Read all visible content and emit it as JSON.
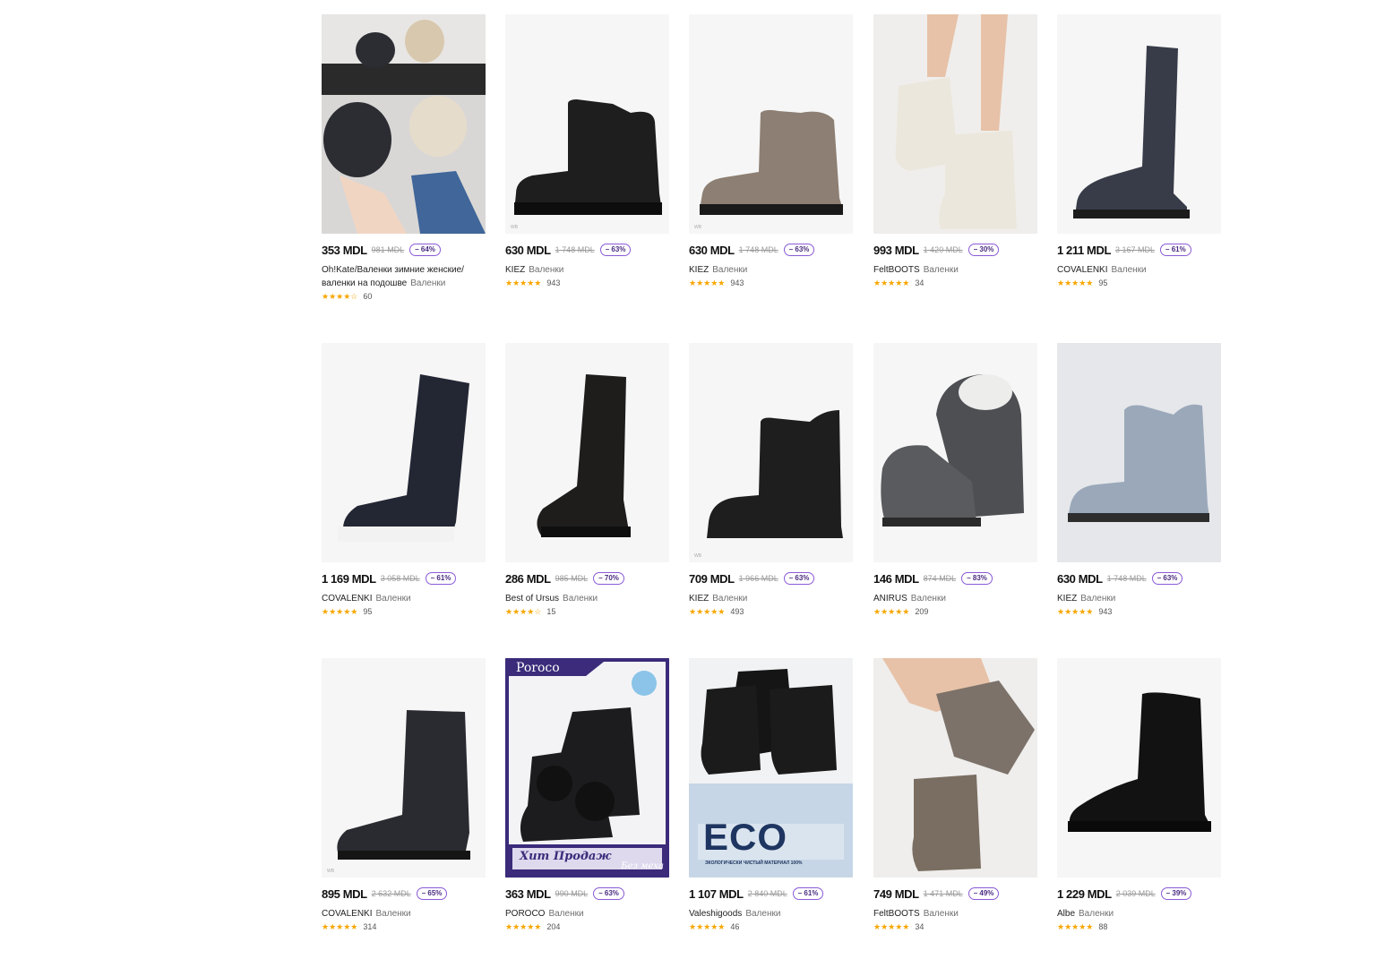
{
  "products": [
    {
      "price": "353 MDL",
      "old": "981 MDL",
      "discount": "– 64%",
      "brand": "Oh!Kate/Валенки зимние женские/валенки на подошве",
      "category": "Валенки",
      "stars": "★★★★☆",
      "reviews": "60",
      "image": "women-dark-boots-photo"
    },
    {
      "price": "630 MDL",
      "old": "1 748 MDL",
      "discount": "– 63%",
      "brand": "KIEZ",
      "category": "Валенки",
      "stars": "★★★★★",
      "reviews": "943",
      "image": "black-short-felt-boot",
      "wb": "WB"
    },
    {
      "price": "630 MDL",
      "old": "1 748 MDL",
      "discount": "– 63%",
      "brand": "KIEZ",
      "category": "Валенки",
      "stars": "★★★★★",
      "reviews": "943",
      "image": "beige-short-felt-boot",
      "wb": "WB"
    },
    {
      "price": "993 MDL",
      "old": "1 420 MDL",
      "discount": "– 30%",
      "brand": "FeltBOOTS",
      "category": "Валенки",
      "stars": "★★★★★",
      "reviews": "34",
      "image": "white-felt-boots-on-legs"
    },
    {
      "price": "1 211 MDL",
      "old": "3 167 MDL",
      "discount": "– 61%",
      "brand": "COVALENKI",
      "category": "Валенки",
      "stars": "★★★★★",
      "reviews": "95",
      "image": "grey-tall-laced-boot"
    },
    {
      "price": "1 169 MDL",
      "old": "3 058 MDL",
      "discount": "– 61%",
      "brand": "COVALENKI",
      "category": "Валенки",
      "stars": "★★★★★",
      "reviews": "95",
      "image": "black-tall-laced-boot-white-sole"
    },
    {
      "price": "286 MDL",
      "old": "985 MDL",
      "discount": "– 70%",
      "brand": "Best of Ursus",
      "category": "Валенки",
      "stars": "★★★★☆",
      "reviews": "15",
      "image": "black-tall-zip-boot"
    },
    {
      "price": "709 MDL",
      "old": "1 966 MDL",
      "discount": "– 63%",
      "brand": "KIEZ",
      "category": "Валенки",
      "stars": "★★★★★",
      "reviews": "493",
      "image": "black-short-felt-boot",
      "wb": "WB"
    },
    {
      "price": "146 MDL",
      "old": "874 MDL",
      "discount": "– 83%",
      "brand": "ANIRUS",
      "category": "Валенки",
      "stars": "★★★★★",
      "reviews": "209",
      "image": "grey-embroidered-slippers"
    },
    {
      "price": "630 MDL",
      "old": "1 748 MDL",
      "discount": "– 63%",
      "brand": "KIEZ",
      "category": "Валенки",
      "stars": "★★★★★",
      "reviews": "943",
      "image": "light-blue-short-felt-boot"
    },
    {
      "price": "895 MDL",
      "old": "2 632 MDL",
      "discount": "– 65%",
      "brand": "COVALENKI",
      "category": "Валенки",
      "stars": "★★★★★",
      "reviews": "314",
      "image": "dark-grey-mid-boot",
      "wb": "WB"
    },
    {
      "price": "363 MDL",
      "old": "990 MDL",
      "discount": "– 63%",
      "brand": "POROCO",
      "category": "Валенки",
      "stars": "★★★★★",
      "reviews": "204",
      "image": "poroco-pompom-boots",
      "overlay": {
        "brand": "Poroco",
        "hit": "Хит Продаж",
        "nofur": "Без меха"
      }
    },
    {
      "price": "1 107 MDL",
      "old": "2 840 MDL",
      "discount": "– 61%",
      "brand": "Valeshigoods",
      "category": "Валенки",
      "stars": "★★★★★",
      "reviews": "46",
      "image": "eco-black-velcro-boots",
      "overlay": {
        "eco": "ECO",
        "eco_sub": "ЭКОЛОГИЧЕСКИ ЧИСТЫЙ МАТЕРИАЛ 100%"
      }
    },
    {
      "price": "749 MDL",
      "old": "1 471 MDL",
      "discount": "– 49%",
      "brand": "FeltBOOTS",
      "category": "Валенки",
      "stars": "★★★★★",
      "reviews": "34",
      "image": "brown-felt-boots-on-legs"
    },
    {
      "price": "1 229 MDL",
      "old": "2 039 MDL",
      "discount": "– 39%",
      "brand": "Albe",
      "category": "Валенки",
      "stars": "★★★★★",
      "reviews": "88",
      "image": "black-laced-ankle-boot"
    }
  ],
  "colors": {
    "star": "#f7a600",
    "discount_border": "#8a5ad6",
    "discount_text": "#4a2c82",
    "old_price": "#9a9a9a"
  }
}
